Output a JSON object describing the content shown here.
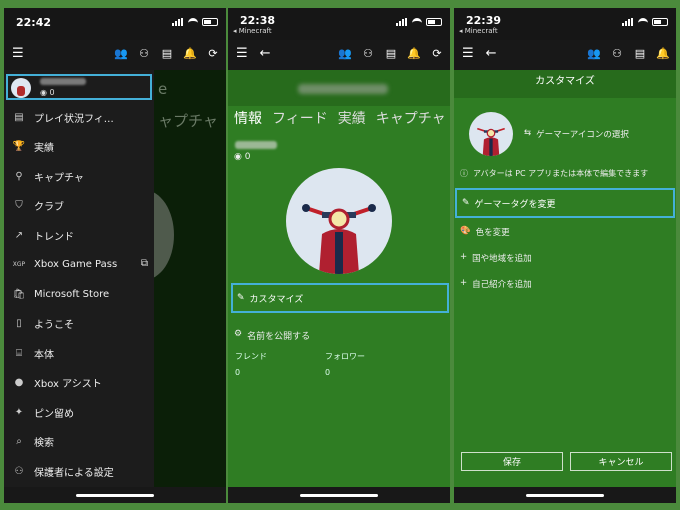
{
  "panels": {
    "p1": {
      "time": "22:42",
      "score": "0",
      "menu": [
        {
          "icon": "▤",
          "label": "プレイ状況フィ…"
        },
        {
          "icon": "🏆",
          "label": "実績"
        },
        {
          "icon": "⚲",
          "label": "キャプチャ"
        },
        {
          "icon": "⛉",
          "label": "クラブ"
        },
        {
          "icon": "↗",
          "label": "トレンド"
        },
        {
          "icon": "XGP",
          "label": "Xbox Game Pass"
        },
        {
          "icon": "🛍",
          "label": "Microsoft Store"
        },
        {
          "icon": "▯",
          "label": "ようこそ"
        },
        {
          "icon": "⌸",
          "label": "本体"
        },
        {
          "icon": "●",
          "label": "Xbox アシスト"
        },
        {
          "icon": "✦",
          "label": "ピン留め"
        },
        {
          "icon": "⌕",
          "label": "検索"
        },
        {
          "icon": "⚇",
          "label": "保護者による設定"
        }
      ],
      "ghost_text": "ャプチャ",
      "ghost_text2": "e"
    },
    "p2": {
      "time": "22:38",
      "back_app": "◂ Minecraft",
      "tabs": [
        "情報",
        "フィード",
        "実績",
        "キャプチャ"
      ],
      "score": "0",
      "customize": "カスタマイズ",
      "publish_name": "名前を公開する",
      "friends_label": "フレンド",
      "friends_value": "0",
      "followers_label": "フォロワー",
      "followers_value": "0"
    },
    "p3": {
      "time": "22:39",
      "back_app": "◂ Minecraft",
      "title": "カスタマイズ",
      "select_icon": "ゲーマーアイコンの選択",
      "avatar_note": "アバターは PC アプリまたは本体で編集できます",
      "change_gamertag": "ゲーマータグを変更",
      "change_color": "色を変更",
      "add_region": "国や地域を追加",
      "add_bio": "自己紹介を追加",
      "save": "保存",
      "cancel": "キャンセル"
    }
  },
  "colors": {
    "accent": "#44b0d8",
    "xbox_green": "#2f7d23",
    "dark": "#1c1c1c"
  }
}
